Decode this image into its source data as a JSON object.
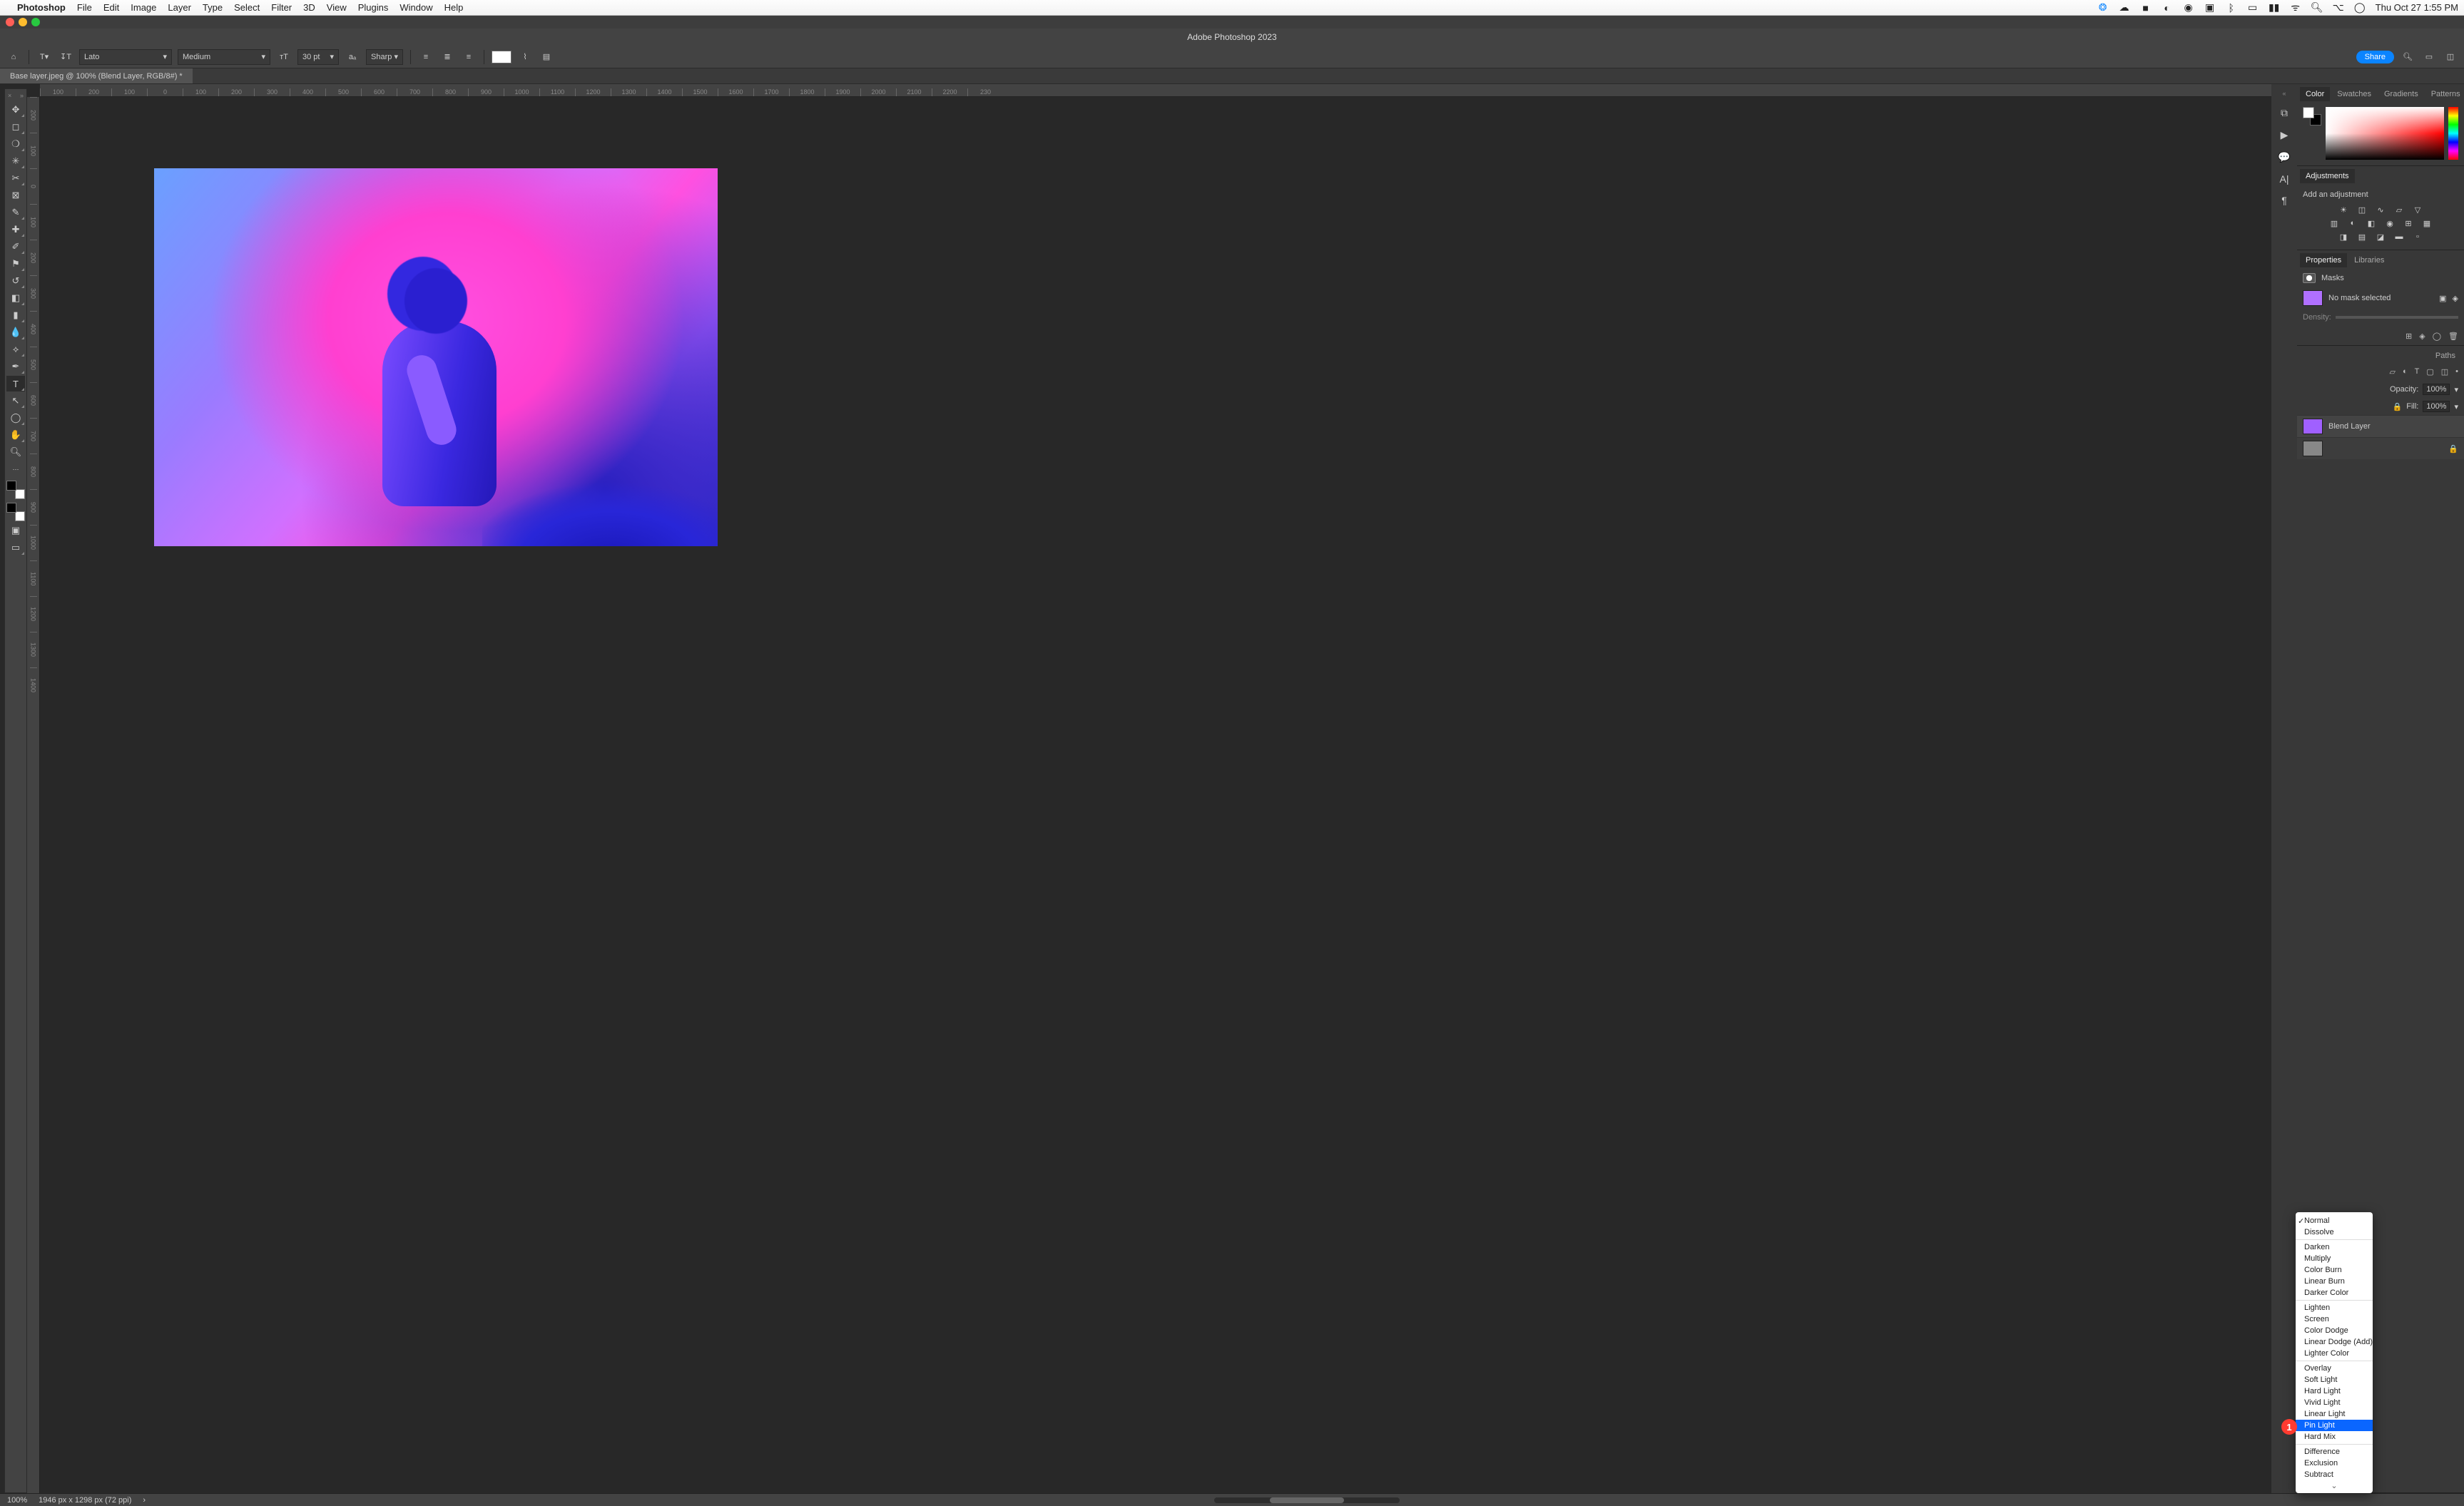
{
  "menubar": {
    "app": "Photoshop",
    "items": [
      "File",
      "Edit",
      "Image",
      "Layer",
      "Type",
      "Select",
      "Filter",
      "3D",
      "View",
      "Plugins",
      "Window",
      "Help"
    ],
    "clock": "Thu Oct 27  1:55 PM"
  },
  "window": {
    "title": "Adobe Photoshop 2023"
  },
  "options_bar": {
    "font_family": "Lato",
    "font_style": "Medium",
    "font_size": "30 pt",
    "aa": "Sharp",
    "share": "Share"
  },
  "doc_tab": "Base layer.jpeg @ 100% (Blend Layer, RGB/8#) *",
  "ruler_h": [
    "100",
    "200",
    "100",
    "0",
    "100",
    "200",
    "300",
    "400",
    "500",
    "600",
    "700",
    "800",
    "900",
    "1000",
    "1100",
    "1200",
    "1300",
    "1400",
    "1500",
    "1600",
    "1700",
    "1800",
    "1900",
    "2000",
    "2100",
    "2200",
    "230"
  ],
  "ruler_v": [
    "200",
    "100",
    "0",
    "100",
    "200",
    "300",
    "400",
    "500",
    "600",
    "700",
    "800",
    "900",
    "1000",
    "1100",
    "1200",
    "1300",
    "1400"
  ],
  "panels": {
    "color_tabs": [
      "Color",
      "Swatches",
      "Gradients",
      "Patterns"
    ],
    "adjustments_tab": "Adjustments",
    "add_adjustment": "Add an adjustment",
    "prop_tabs": [
      "Properties",
      "Libraries"
    ],
    "masks_label": "Masks",
    "no_mask": "No mask selected",
    "density_label": "Density:",
    "layers_tabs_visible": "Paths",
    "opacity_label": "Opacity:",
    "opacity_value": "100%",
    "fill_label": "Fill:",
    "fill_value": "100%",
    "layer_name": "Blend Layer"
  },
  "blend_modes": {
    "checked": "Normal",
    "highlighted": "Pin Light",
    "groups": [
      [
        "Normal",
        "Dissolve"
      ],
      [
        "Darken",
        "Multiply",
        "Color Burn",
        "Linear Burn",
        "Darker Color"
      ],
      [
        "Lighten",
        "Screen",
        "Color Dodge",
        "Linear Dodge (Add)",
        "Lighter Color"
      ],
      [
        "Overlay",
        "Soft Light",
        "Hard Light",
        "Vivid Light",
        "Linear Light",
        "Pin Light",
        "Hard Mix"
      ],
      [
        "Difference",
        "Exclusion",
        "Subtract"
      ]
    ]
  },
  "callout": "1",
  "statusbar": {
    "zoom": "100%",
    "doc_info": "1946 px x 1298 px (72 ppi)"
  }
}
